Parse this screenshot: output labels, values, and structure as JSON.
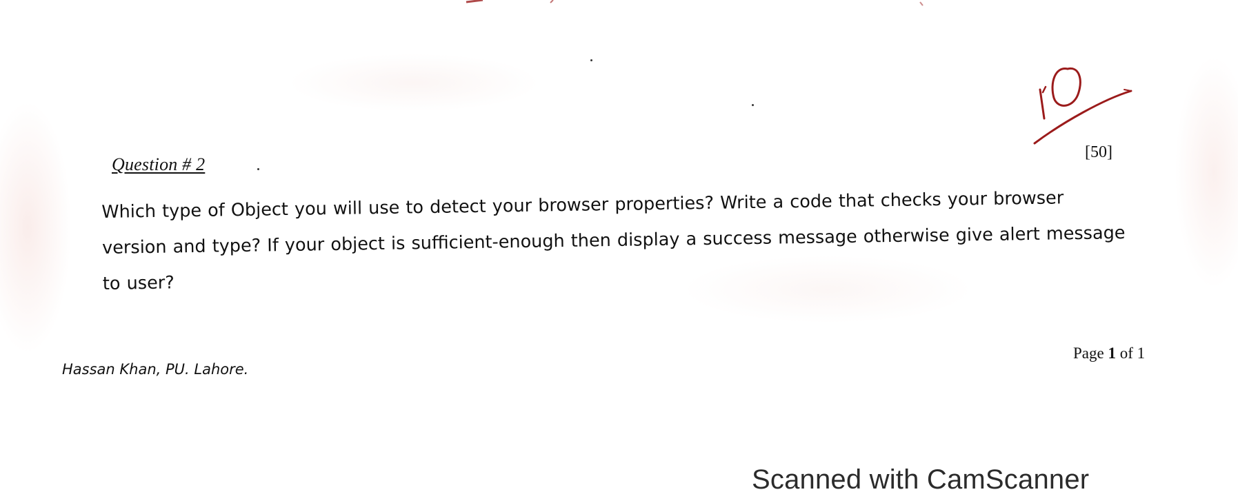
{
  "document": {
    "question_heading": "Question # 2",
    "marks_total": "[50]",
    "question_lines": [
      "Which type of Object you will use to detect your browser properties? Write a code that checks your browser",
      "version and type? If your object is sufficient-enough then display a success message otherwise give alert message",
      "to user?"
    ],
    "author": "Hassan Khan, PU. Lahore.",
    "page_number": {
      "prefix": "Page ",
      "current": "1",
      "middle": " of ",
      "total": "1"
    }
  },
  "grading": {
    "score": "10",
    "ink_color": "#9b1b1b"
  },
  "watermark": {
    "text": "Scanned with CamScanner"
  }
}
